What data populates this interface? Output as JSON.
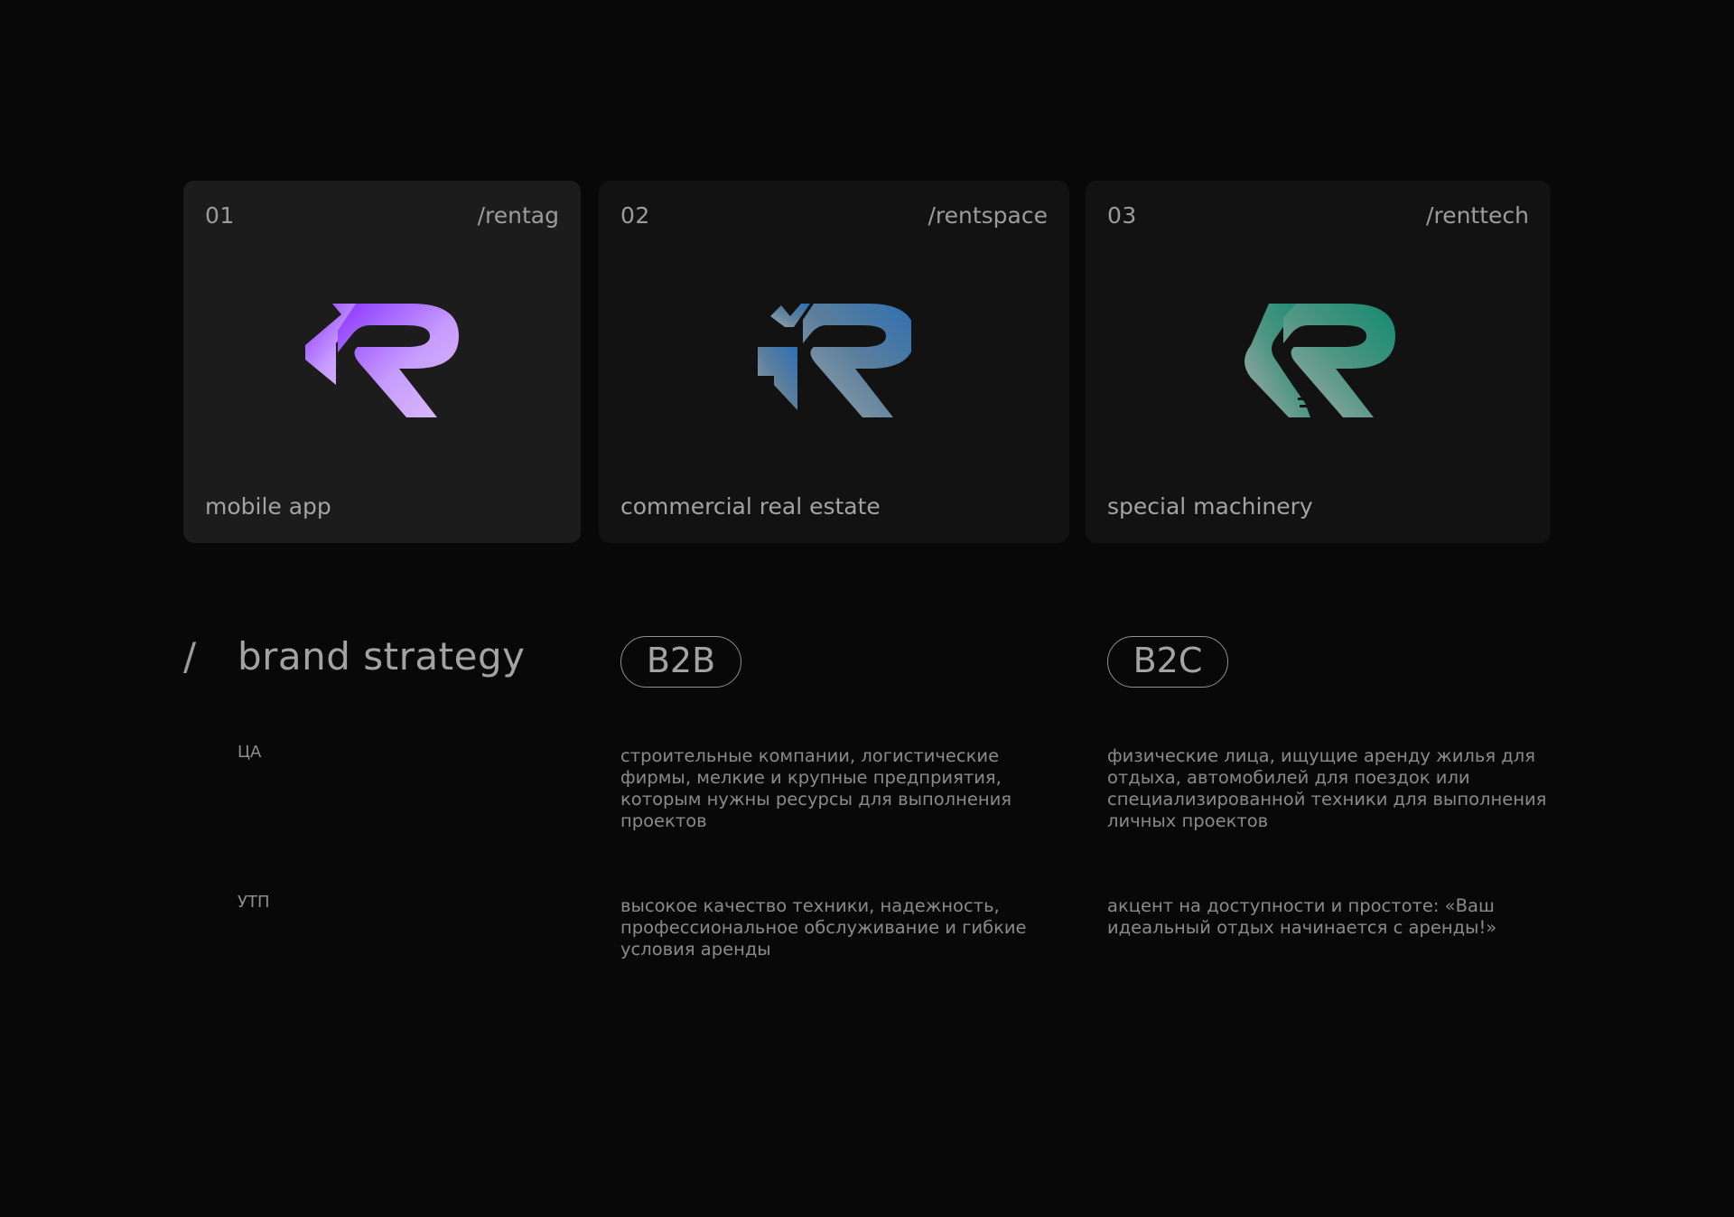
{
  "cards": [
    {
      "number": "01",
      "slug": "/rentag",
      "caption": "mobile app",
      "logo_icon": "rentag-logo-icon",
      "active": true,
      "gradient": [
        "#8a35ff",
        "#c79cff",
        "#dcbdf5"
      ]
    },
    {
      "number": "02",
      "slug": "/rentspace",
      "caption": "commercial real estate",
      "logo_icon": "rentspace-logo-icon",
      "active": false,
      "gradient": [
        "#2e6fb3",
        "#5c7f9c",
        "#9aa6ad"
      ]
    },
    {
      "number": "03",
      "slug": "/renttech",
      "caption": "special machinery",
      "logo_icon": "renttech-logo-icon",
      "active": false,
      "gradient": [
        "#138a70",
        "#4f9683",
        "#a8adab"
      ]
    }
  ],
  "strategy": {
    "slash": "/",
    "title": "brand strategy",
    "segments": [
      "B2B",
      "B2C"
    ],
    "rows": [
      {
        "label": "ЦА",
        "b2b": "строительные компании, логистические фирмы, мелкие и крупные предприятия, которым нужны ресурсы для выполнения проектов",
        "b2c": "физические лица, ищущие аренду жилья для отдыха, автомобилей для поездок или специализированной техники для выполнения личных проектов"
      },
      {
        "label": "УТП",
        "b2b": "высокое качество техники, надежность, профессиональное обслуживание и гибкие условия аренды",
        "b2c": "акцент на доступности и простоте: «Ваш идеальный отдых начинается с аренды!»"
      }
    ]
  }
}
